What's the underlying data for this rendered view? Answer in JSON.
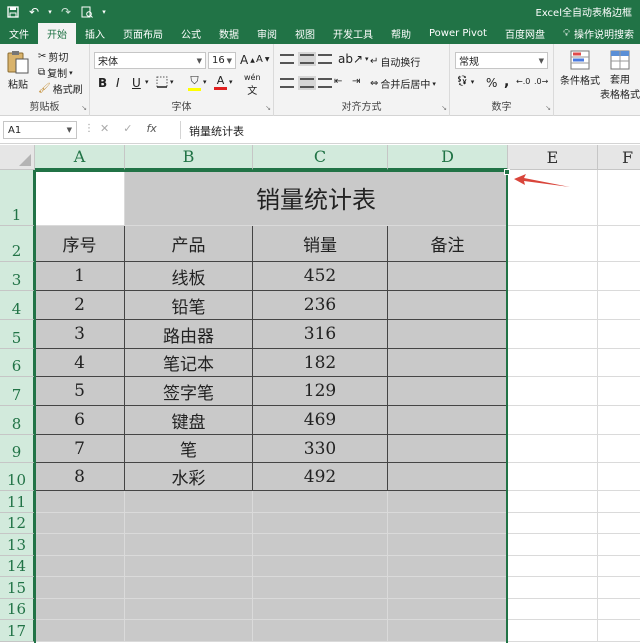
{
  "titlebar": {
    "title": "Excel全自动表格边框",
    "icons": [
      "save-icon",
      "undo-icon",
      "redo-icon",
      "print-preview-icon",
      "customize-icon"
    ]
  },
  "tabs": [
    {
      "label": "文件"
    },
    {
      "label": "开始",
      "active": true
    },
    {
      "label": "插入"
    },
    {
      "label": "页面布局"
    },
    {
      "label": "公式"
    },
    {
      "label": "数据"
    },
    {
      "label": "审阅"
    },
    {
      "label": "视图"
    },
    {
      "label": "开发工具"
    },
    {
      "label": "帮助"
    },
    {
      "label": "Power Pivot"
    },
    {
      "label": "百度网盘"
    },
    {
      "label": "操作说明搜索"
    }
  ],
  "ribbon": {
    "clipboard": {
      "paste": "粘贴",
      "cut": "剪切",
      "copy": "复制",
      "format_painter": "格式刷",
      "label": "剪贴板"
    },
    "font": {
      "name": "宋体",
      "size": "16",
      "grow": "A",
      "shrink": "A",
      "bold": "B",
      "italic": "I",
      "underline": "U",
      "label": "字体",
      "wen": "wén"
    },
    "alignment": {
      "wrap": "自动换行",
      "merge": "合并后居中",
      "label": "对齐方式"
    },
    "number": {
      "format": "常规",
      "percent": "%",
      "comma": ",",
      "label": "数字"
    },
    "styles": {
      "conditional": "条件格式",
      "table": "套用",
      "table2": "表格格式"
    }
  },
  "formula_bar": {
    "name_box": "A1",
    "fx": "fx",
    "content": "销量统计表"
  },
  "columns": [
    "A",
    "B",
    "C",
    "D",
    "E",
    "F"
  ],
  "rows": [
    "1",
    "2",
    "3",
    "4",
    "5",
    "6",
    "7",
    "8",
    "9",
    "10",
    "11",
    "12",
    "13",
    "14",
    "15",
    "16",
    "17"
  ],
  "sheet": {
    "title": "销量统计表",
    "headers": [
      "序号",
      "产品",
      "销量",
      "备注"
    ],
    "data": [
      [
        "1",
        "线板",
        "452",
        ""
      ],
      [
        "2",
        "铅笔",
        "236",
        ""
      ],
      [
        "3",
        "路由器",
        "316",
        ""
      ],
      [
        "4",
        "笔记本",
        "182",
        ""
      ],
      [
        "5",
        "签字笔",
        "129",
        ""
      ],
      [
        "6",
        "键盘",
        "469",
        ""
      ],
      [
        "7",
        "笔",
        "330",
        ""
      ],
      [
        "8",
        "水彩",
        "492",
        ""
      ]
    ]
  },
  "colors": {
    "accent": "#217346",
    "selected_fill": "#c9c9c9",
    "arrow": "#d9453b"
  }
}
